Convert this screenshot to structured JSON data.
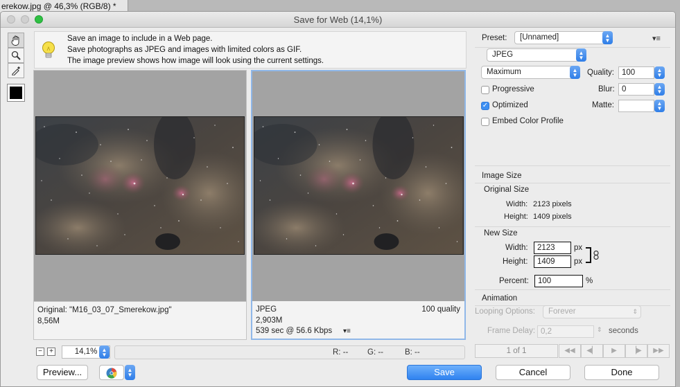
{
  "background_tab": {
    "title": "erekow.jpg @ 46,3% (RGB/8) *"
  },
  "window": {
    "title": "Save for Web (14,1%)"
  },
  "tools": [
    "hand-tool",
    "zoom-tool",
    "eyedropper-tool"
  ],
  "hint": {
    "lines": [
      "Save an image to include in a Web page.",
      "Save photographs as JPEG and images with limited colors as GIF.",
      "The image preview shows how image will look using the current settings."
    ]
  },
  "original_pane": {
    "name": "Original: \"M16_03_07_Smerekow.jpg\"",
    "size": "8,56M"
  },
  "optimized_pane": {
    "format": "JPEG",
    "quality": "100 quality",
    "size": "2,903M",
    "download": "539 sec @ 56.6 Kbps"
  },
  "bottom_bar": {
    "zoom_minus": "−",
    "zoom_plus": "+",
    "zoom_value": "14,1%",
    "r": "R: --",
    "g": "G: --",
    "b": "B: --"
  },
  "buttons": {
    "preview": "Preview...",
    "save": "Save",
    "cancel": "Cancel",
    "done": "Done"
  },
  "settings": {
    "preset_label": "Preset:",
    "preset_value": "[Unnamed]",
    "format": "JPEG",
    "compression": "Maximum",
    "quality_label": "Quality:",
    "quality_value": "100",
    "progressive_label": "Progressive",
    "progressive_checked": false,
    "blur_label": "Blur:",
    "blur_value": "0",
    "optimized_label": "Optimized",
    "optimized_checked": true,
    "matte_label": "Matte:",
    "matte_value": "",
    "embed_label": "Embed Color Profile",
    "embed_checked": false
  },
  "image_size": {
    "heading": "Image Size",
    "original_heading": "Original Size",
    "width_label": "Width:",
    "width_value": "2123 pixels",
    "height_label": "Height:",
    "height_value": "1409 pixels",
    "new_heading": "New Size",
    "new_width_label": "Width:",
    "new_width_value": "2123",
    "new_height_label": "Height:",
    "new_height_value": "1409",
    "unit": "px",
    "percent_label": "Percent:",
    "percent_value": "100",
    "percent_unit": "%"
  },
  "animation": {
    "heading": "Animation",
    "looping_label": "Looping Options:",
    "looping_value": "Forever",
    "delay_label": "Frame Delay:",
    "delay_value": "0,2",
    "delay_unit": "seconds",
    "frame_counter": "1 of 1"
  },
  "colors": {
    "accent": "#3d8ff2",
    "selection_border": "#8fb7e8",
    "window_bg": "#ececec"
  }
}
